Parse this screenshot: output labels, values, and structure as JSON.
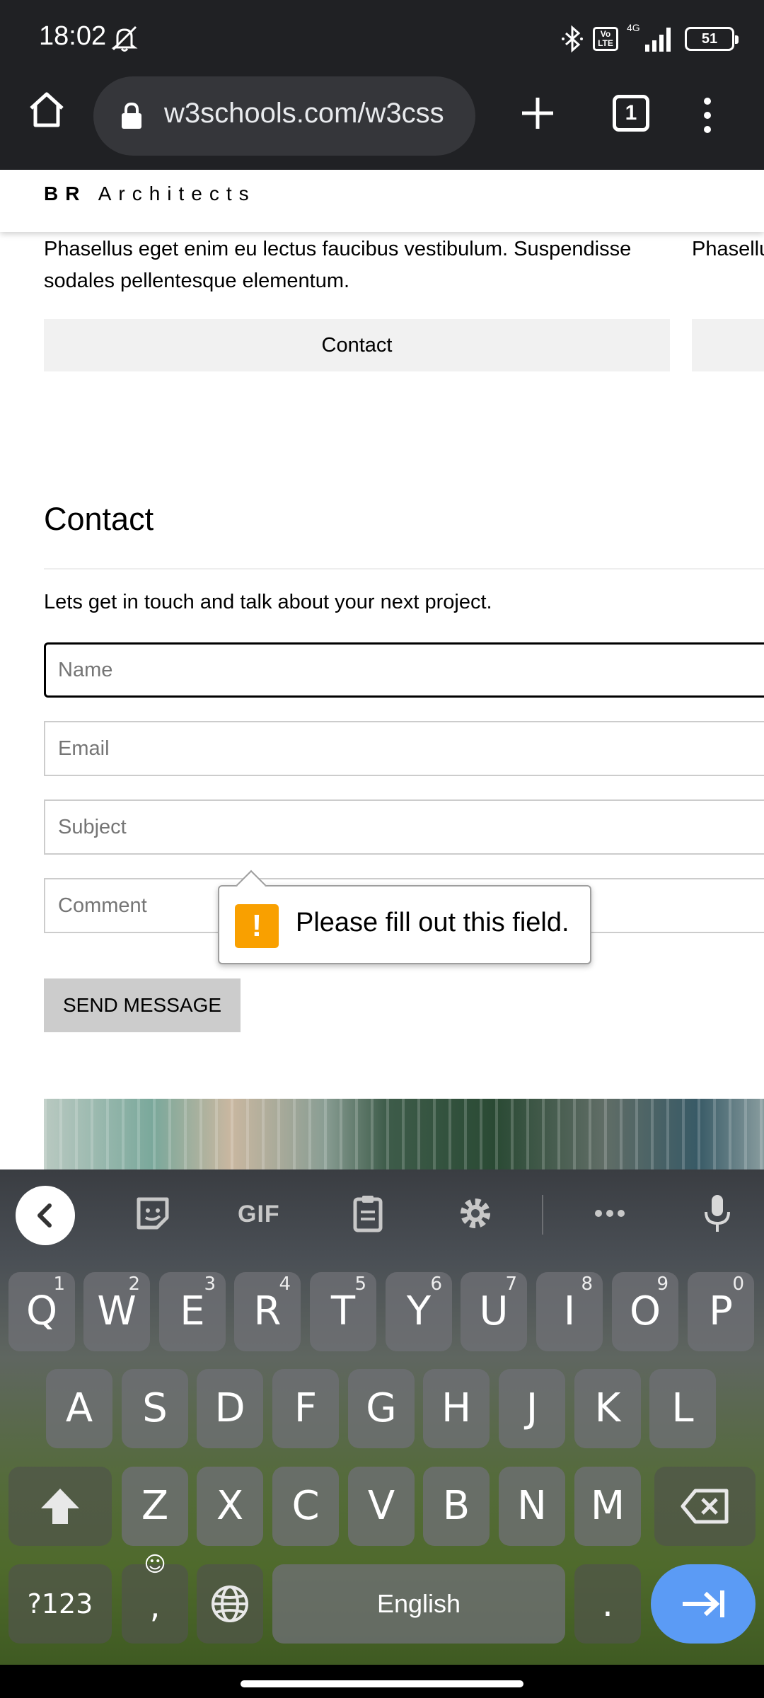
{
  "status_bar": {
    "time": "18:02",
    "network": "4G",
    "volte": "Vo LTE",
    "battery": "51"
  },
  "browser": {
    "url": "w3schools.com/w3css",
    "tab_count": "1"
  },
  "page": {
    "brand_bold": "BR",
    "brand_rest": "Architects",
    "card_text": "Phasellus eget enim eu lectus faucibus vestibulum. Suspendisse sodales pellentesque elementum.",
    "card_text_clipped": "Phasellus sodales",
    "contact_button": "Contact",
    "section_title": "Contact",
    "section_desc": "Lets get in touch and talk about your next project.",
    "form": {
      "name_placeholder": "Name",
      "email_placeholder": "Email",
      "subject_placeholder": "Subject",
      "comment_placeholder": "Comment",
      "send_label": "SEND MESSAGE"
    },
    "validation": {
      "icon": "!",
      "message": "Please fill out this field."
    }
  },
  "keyboard": {
    "toolbar": {
      "gif_label": "GIF",
      "icons": [
        "back-arrow-icon",
        "sticker-icon",
        "clipboard-icon",
        "settings-icon",
        "more-icon",
        "microphone-icon"
      ]
    },
    "row1": [
      {
        "label": "Q",
        "hint": "1"
      },
      {
        "label": "W",
        "hint": "2"
      },
      {
        "label": "E",
        "hint": "3"
      },
      {
        "label": "R",
        "hint": "4"
      },
      {
        "label": "T",
        "hint": "5"
      },
      {
        "label": "Y",
        "hint": "6"
      },
      {
        "label": "U",
        "hint": "7"
      },
      {
        "label": "I",
        "hint": "8"
      },
      {
        "label": "O",
        "hint": "9"
      },
      {
        "label": "P",
        "hint": "0"
      }
    ],
    "row2": [
      "A",
      "S",
      "D",
      "F",
      "G",
      "H",
      "J",
      "K",
      "L"
    ],
    "row3": [
      "Z",
      "X",
      "C",
      "V",
      "B",
      "N",
      "M"
    ],
    "symbols_label": "?123",
    "comma_label": ",",
    "space_label": "English",
    "period_label": "."
  }
}
